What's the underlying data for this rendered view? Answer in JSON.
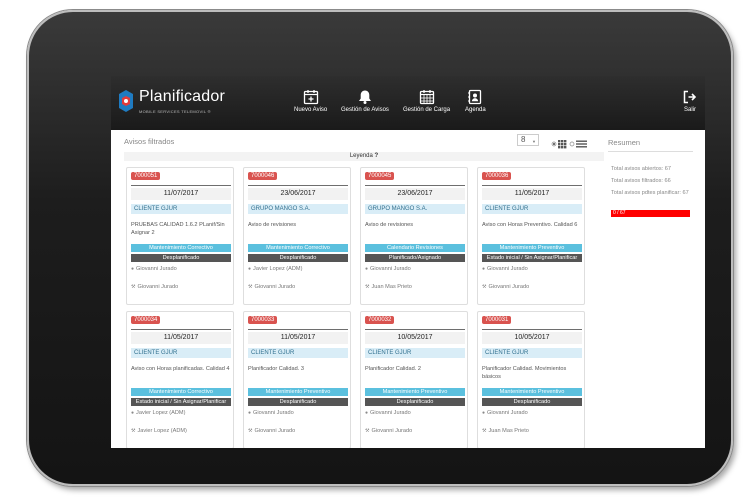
{
  "app": {
    "title": "Planificador",
    "subtitle": "MOBILE SERVICES TELEMOVIL ®"
  },
  "nav": [
    {
      "label": "Nuevo Aviso",
      "icon": "calendar-plus-icon"
    },
    {
      "label": "Gestión de Avisos",
      "icon": "bell-icon"
    },
    {
      "label": "Gestión de Carga",
      "icon": "calendar-grid-icon"
    },
    {
      "label": "Agenda",
      "icon": "contact-book-icon"
    }
  ],
  "logout": {
    "label": "Salir",
    "icon": "sign-out-icon"
  },
  "main": {
    "section_title": "Avisos filtrados",
    "page_size": "8",
    "legend_label": "Leyenda",
    "legend_help": "?"
  },
  "cards": [
    {
      "id": "7000051",
      "date": "11/07/2017",
      "client": "CLIENTE GJUR",
      "desc": "PRUEBAS CALIDAD 1.6.2 PLanif/Sin Asignar 2",
      "type": "Mantenimiento Correctivo",
      "state": "Desplanificado",
      "user1": "Giovanni Jurado",
      "user2": "Giovanni Jurado"
    },
    {
      "id": "7000046",
      "date": "23/06/2017",
      "client": "GRUPO MANGO S.A.",
      "desc": "Aviso de revisiones",
      "type": "Mantenimiento Correctivo",
      "state": "Desplanificado",
      "user1": "Javier Lopez (ADM)",
      "user2": "Giovanni Jurado"
    },
    {
      "id": "7000045",
      "date": "23/06/2017",
      "client": "GRUPO MANGO S.A.",
      "desc": "Aviso de revisiones",
      "type": "Calendario Revisiones",
      "state": "Planificado/Asignado",
      "user1": "Giovanni Jurado",
      "user2": "Juan Mas Prieto"
    },
    {
      "id": "7000036",
      "date": "11/05/2017",
      "client": "CLIENTE GJUR",
      "desc": "Aviso con Horas Preventivo. Calidad 6",
      "type": "Mantenimiento Preventivo",
      "state": "Estado inicial / Sin Asignar/Planificar",
      "user1": "Giovanni Jurado",
      "user2": "Giovanni Jurado"
    },
    {
      "id": "7000034",
      "date": "11/05/2017",
      "client": "CLIENTE GJUR",
      "desc": "Aviso con Horas planificadas. Calidad 4",
      "type": "Mantenimiento Correctivo",
      "state": "Estado inicial / Sin Asignar/Planificar",
      "user1": "Javier Lopez (ADM)",
      "user2": "Javier Lopez (ADM)"
    },
    {
      "id": "7000033",
      "date": "11/05/2017",
      "client": "CLIENTE GJUR",
      "desc": "Planificador Calidad. 3",
      "type": "Mantenimiento Preventivo",
      "state": "Desplanificado",
      "user1": "Giovanni Jurado",
      "user2": "Giovanni Jurado"
    },
    {
      "id": "7000032",
      "date": "10/05/2017",
      "client": "CLIENTE GJUR",
      "desc": "Planificador Calidad. 2",
      "type": "Mantenimiento Preventivo",
      "state": "Desplanificado",
      "user1": "Giovanni Jurado",
      "user2": "Giovanni Jurado"
    },
    {
      "id": "7000031",
      "date": "10/05/2017",
      "client": "CLIENTE GJUR",
      "desc": "Planificador Calidad. Movimientos básicos",
      "type": "Mantenimiento Preventivo",
      "state": "Desplanificado",
      "user1": "Giovanni Jurado",
      "user2": "Juan Mas Prieto"
    }
  ],
  "summary": {
    "title": "Resumen",
    "open": "Total avisos abiertos: 67",
    "filtered": "Total avisos filtrados: 66",
    "pending": "Total avisos pdtes planificar: 67",
    "progress_label": "0 / 67",
    "progress_fraction": 1.0
  },
  "colors": {
    "id_badge": "#d9534f",
    "client_bg": "#d9edf7",
    "type_badge": "#5bc0de",
    "state_badge": "#555555",
    "summary_bar": "#ff0000"
  }
}
